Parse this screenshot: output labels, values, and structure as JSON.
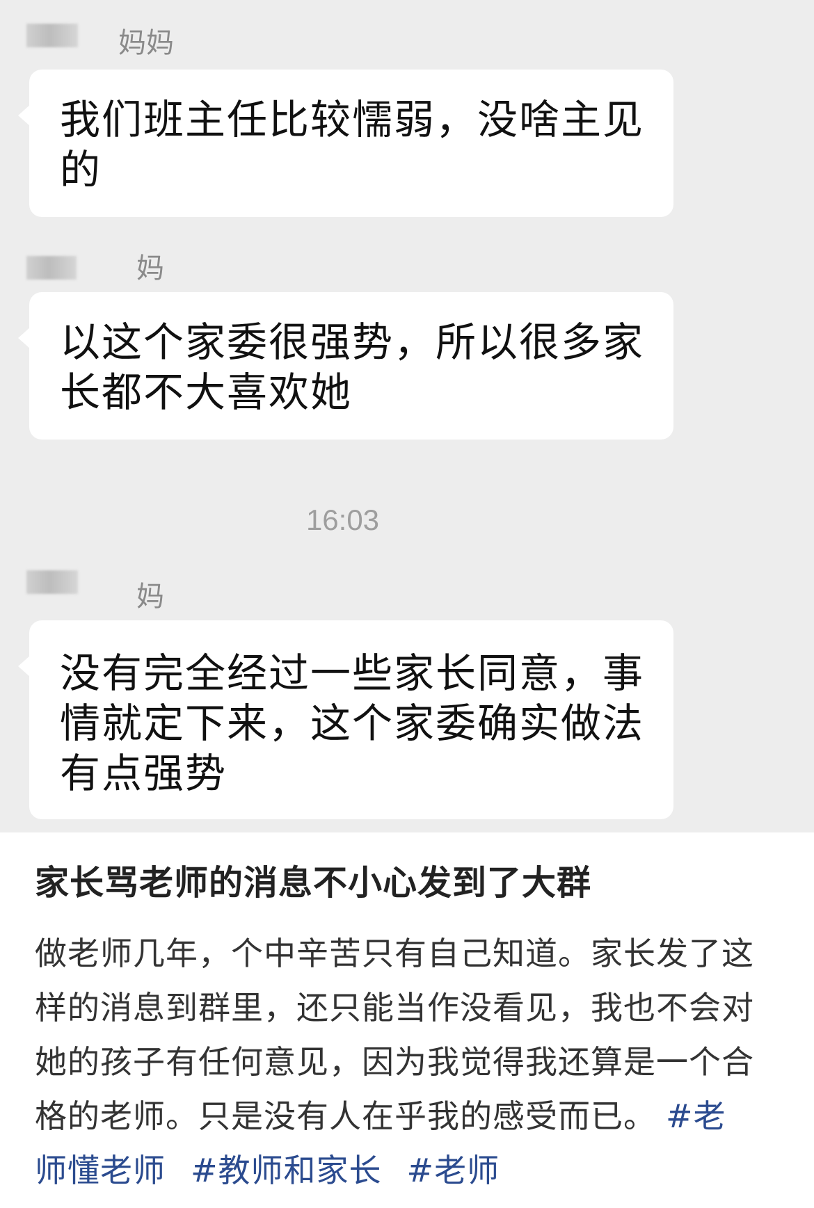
{
  "chat": {
    "messages": [
      {
        "sender": "妈妈",
        "text": "我们班主任比较懦弱，没啥主见的"
      },
      {
        "sender": "妈",
        "text": "以这个家委很强势，所以很多家长都不大喜欢她"
      },
      {
        "sender": "妈",
        "text": "没有完全经过一些家长同意，事情就定下来，这个家委确实做法有点强势"
      }
    ],
    "timestamp": "16:03"
  },
  "post": {
    "title": "家长骂老师的消息不小心发到了大群",
    "body": "做老师几年，个中辛苦只有自己知道。家长发了这样的消息到群里，还只能当作没看见，我也不会对她的孩子有任何意见，因为我觉得我还算是一个合格的老师。只是没有人在乎我的感受而已。",
    "hashtags": [
      "#老师懂老师",
      "#教师和家长",
      "#老师"
    ]
  },
  "colors": {
    "chat_background": "#ededed",
    "bubble": "#ffffff",
    "hashtag": "#2b4b8f"
  }
}
